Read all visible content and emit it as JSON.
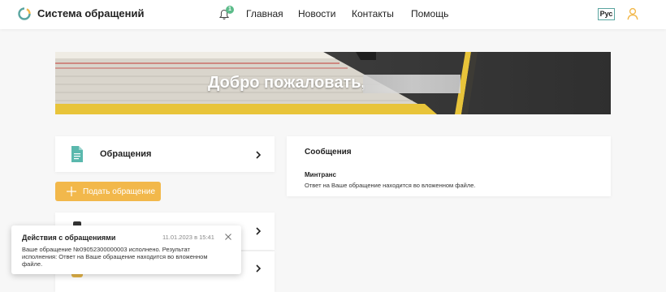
{
  "header": {
    "brand": "Система обращений",
    "notification_count": "1",
    "nav": [
      "Главная",
      "Новости",
      "Контакты",
      "Помощь"
    ],
    "language": "Рус"
  },
  "banner": {
    "greeting": "Добро пожаловать,"
  },
  "appeals": {
    "label": "Обращения",
    "submit_button": "Подать обращение"
  },
  "messages": {
    "title": "Сообщения",
    "items": [
      {
        "sender": "Минтранс",
        "text": "Ответ на Ваше обращение находится во вложенном файле."
      }
    ]
  },
  "toast": {
    "title": "Действия с обращениями",
    "time": "11.01.2023 в 15:41",
    "body": "Ваше обращение №09052300000003 исполнено. Результат исполнения: Ответ на Ваше обращение находится во вложенном файле."
  },
  "colors": {
    "accent": "#f2b84b",
    "badge": "#5cbc8a",
    "doc_icon": "#5ab8ad"
  }
}
